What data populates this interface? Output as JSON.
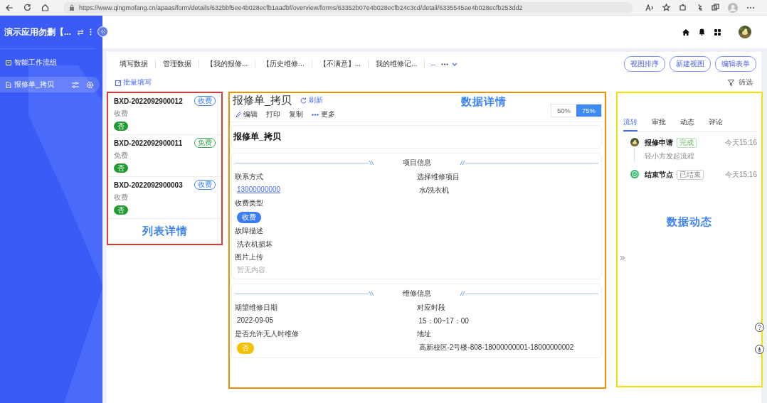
{
  "browser": {
    "url": "https://www.qingmofang.cn/apaas/form/details/632bbf5ee4b028ecfb1aadbf/overview/forms/63352b07e4b028ecfb24c3cd/detail/6335545ae4b028ecfb253dd2"
  },
  "app": {
    "title": "演示应用勿删【...",
    "nav": [
      {
        "label": "智能工作流组",
        "selected": false
      },
      {
        "label": "报修单_拷贝",
        "selected": true
      }
    ]
  },
  "views": {
    "tabs": [
      {
        "label": "填写数据",
        "selected": false
      },
      {
        "label": "管理数据",
        "selected": false
      },
      {
        "label": "【我的报修...",
        "selected": false
      },
      {
        "label": "【历史维修...",
        "selected": false
      },
      {
        "label": "【不满意】...",
        "selected": false
      },
      {
        "label": "我的维修记...",
        "selected": false
      }
    ],
    "more_label": "--",
    "buttons": [
      "视图排序",
      "新建视图",
      "编辑表单"
    ],
    "batch_fill": "批量填写",
    "filter": "筛选"
  },
  "records": {
    "items": [
      {
        "id": "BXD-2022092900012",
        "tag": "收费",
        "color": "#3b82f6",
        "fee_type": "收费",
        "flag": "否"
      },
      {
        "id": "BXD-2022092900011",
        "tag": "免费",
        "color": "#34a853",
        "fee_type": "免费",
        "flag": "否"
      },
      {
        "id": "BXD-2022092900003",
        "tag": "收费",
        "color": "#3b82f6",
        "fee_type": "收费",
        "flag": "否"
      }
    ],
    "annotation": "列表详情"
  },
  "detail": {
    "title": "报修单_拷贝",
    "refresh": "刷新",
    "actions": [
      {
        "label": "编辑",
        "kind": "edit"
      },
      {
        "label": "打印",
        "kind": "plain"
      },
      {
        "label": "复制",
        "kind": "plain"
      },
      {
        "label": "更多",
        "kind": "more"
      }
    ],
    "zoom": [
      {
        "label": "50%",
        "selected": false
      },
      {
        "label": "75%",
        "selected": true
      }
    ],
    "annotation": "数据详情",
    "form_title": "报修单_拷贝",
    "sections": [
      {
        "title": "项目信息",
        "rows": [
          [
            {
              "label": "联系方式",
              "value": "13000000000",
              "kind": "link"
            },
            {
              "label": "选择维修项目",
              "value": "水/洗衣机",
              "kind": "text"
            }
          ],
          [
            {
              "label": "收费类型",
              "value": "收费",
              "kind": "pill",
              "color": "#3b7cf0"
            }
          ],
          [
            {
              "label": "故障描述",
              "value": "洗衣机损坏",
              "kind": "text"
            }
          ],
          [
            {
              "label": "图片上传",
              "value": "暂无内容",
              "kind": "empty"
            }
          ]
        ]
      },
      {
        "title": "维修信息",
        "rows": [
          [
            {
              "label": "期望维修日期",
              "value": "2022-09-05",
              "kind": "text"
            },
            {
              "label": "对应时段",
              "value": "15：00~17：00",
              "kind": "text"
            }
          ],
          [
            {
              "label": "是否允许无人时维修",
              "value": "否",
              "kind": "pill",
              "color": "#f5c000"
            },
            {
              "label": "地址",
              "value": "高新校区-2号楼-808-18000000001-18000000002",
              "kind": "text"
            }
          ]
        ]
      }
    ]
  },
  "flow": {
    "tabs": [
      {
        "label": "流转",
        "selected": true
      },
      {
        "label": "审批",
        "selected": false
      },
      {
        "label": "动态",
        "selected": false
      },
      {
        "label": "评论",
        "selected": false
      }
    ],
    "steps": [
      {
        "kind": "start",
        "title": "报修申请",
        "status": "完成",
        "time": "今天15:16",
        "note": "轻小方发起流程"
      },
      {
        "kind": "end",
        "title": "结束节点",
        "status": "已结束",
        "time": "今天15:16"
      }
    ],
    "annotation": "数据动态"
  }
}
